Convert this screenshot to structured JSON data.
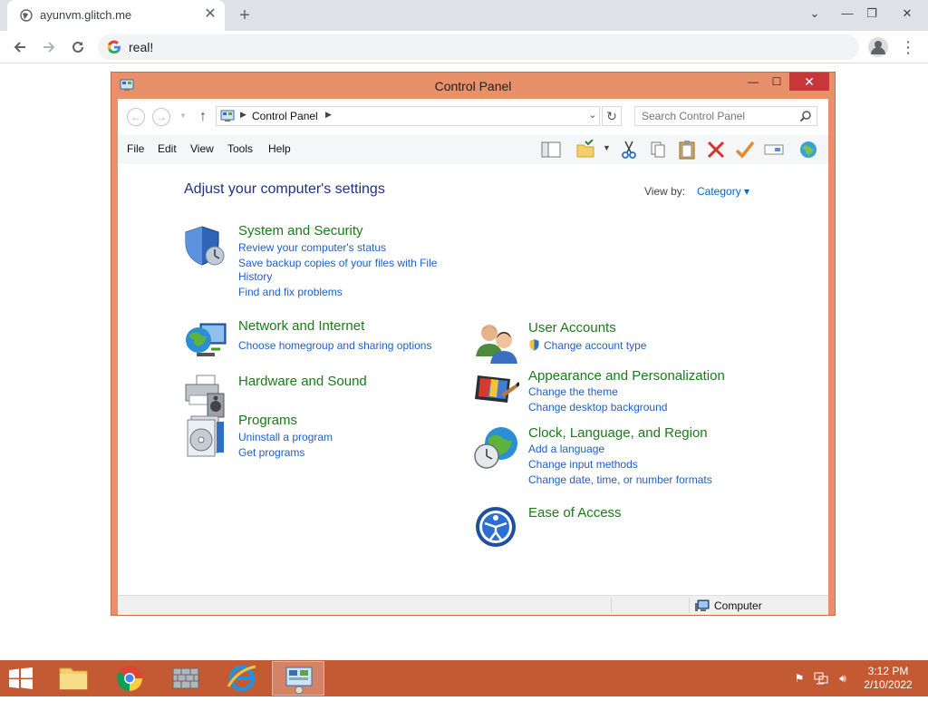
{
  "browser": {
    "tab_title": "ayunvm.glitch.me",
    "tab_close": "✕",
    "new_tab": "+",
    "omnibox_value": "real!",
    "win_buttons": {
      "dropdown": "⌄",
      "minimize": "—",
      "restore": "❐",
      "close": "✕"
    }
  },
  "window": {
    "title": "Control Panel",
    "buttons": {
      "minimize": "—",
      "maximize": "☐",
      "close": "✕"
    }
  },
  "address": {
    "breadcrumb": "Control Panel",
    "search_placeholder": "Search Control Panel"
  },
  "menu": [
    "File",
    "Edit",
    "View",
    "Tools",
    "Help"
  ],
  "content": {
    "heading": "Adjust your computer's settings",
    "view_by_label": "View by:",
    "view_by_value": "Category ▾",
    "categories_left": [
      {
        "title": "System and Security",
        "links": [
          "Review your computer's status",
          "Save backup copies of your files with File",
          "History",
          "Find and fix problems"
        ]
      },
      {
        "title": "Network and Internet",
        "links": [
          "Choose homegroup and sharing options"
        ]
      },
      {
        "title": "Hardware and Sound",
        "links": []
      },
      {
        "title": "Programs",
        "links": [
          "Uninstall a program",
          "Get programs"
        ]
      }
    ],
    "categories_right": [
      {
        "title": "User Accounts",
        "links": [
          "Change account type"
        ]
      },
      {
        "title": "Appearance and Personalization",
        "links": [
          "Change the theme",
          "Change desktop background"
        ]
      },
      {
        "title": "Clock, Language, and Region",
        "links": [
          "Add a language",
          "Change input methods",
          "Change date, time, or number formats"
        ]
      },
      {
        "title": "Ease of Access",
        "links": []
      }
    ]
  },
  "status": {
    "computer": "Computer"
  },
  "taskbar": {
    "time": "3:12 PM",
    "date": "2/10/2022"
  },
  "colors": {
    "taskbar": "#c45a33",
    "window_frame": "#e8906a",
    "close_red": "#c7373a",
    "link_blue": "#1f5fc6",
    "category_green": "#1a7a1a"
  }
}
